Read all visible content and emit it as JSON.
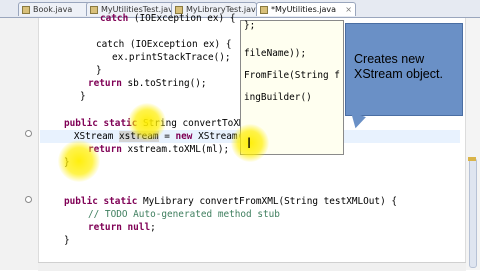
{
  "tabs": [
    {
      "label": "Book.java",
      "active": false
    },
    {
      "label": "MyUtilitiesTest.java",
      "active": false
    },
    {
      "label": "MyLibraryTest.java",
      "active": false
    },
    {
      "label": "*MyUtilities.java",
      "active": true
    }
  ],
  "close_glyph": "×",
  "code_lines": {
    "l1": "catch (IOException ex) {",
    "l2": "ex.printStackTrace();",
    "l3": "}",
    "l4": "return sb.toString();",
    "l5": "}",
    "l6": "public static String convertToXML(MyLibrary ml) {",
    "l7": "XStream xstream = new XStream(new DomDriver());",
    "l8": "return xstream.toXML(ml);",
    "l9": "}",
    "l10": "public static MyLibrary convertFromXML(String testXMLOut) {",
    "l11": "// TODO Auto-generated method stub",
    "l12": "return null;",
    "l13": "}"
  },
  "popup_lines": {
    "p0": "",
    "p1": "fileName));",
    "p2": "FromFile(String f",
    "p3": "ingBuilder()"
  },
  "callout": {
    "text": "Creates new XStream object."
  },
  "colors": {
    "keyword": "#7f0055",
    "comment": "#3f7f5f",
    "highlight_line": "#e8f2fe",
    "callout_bg": "#6a90c6",
    "spotlight": "#ffee00"
  }
}
